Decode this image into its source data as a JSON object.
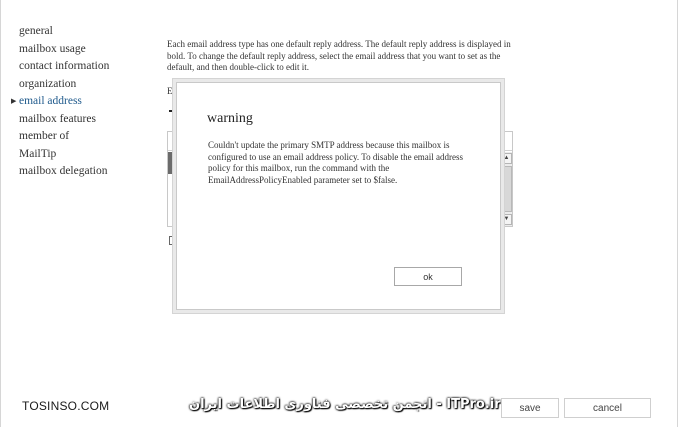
{
  "nav": {
    "items": [
      {
        "label": "general"
      },
      {
        "label": "mailbox usage"
      },
      {
        "label": "contact information"
      },
      {
        "label": "organization"
      },
      {
        "label": "email address"
      },
      {
        "label": "mailbox features"
      },
      {
        "label": "member of"
      },
      {
        "label": "MailTip"
      },
      {
        "label": "mailbox delegation"
      }
    ],
    "active_marker": "▶"
  },
  "content": {
    "description": "Each email address type has one default reply address. The default reply address is displayed in bold. To change the default reply address, select the email address that you want to set as the default, and then double-click to edit it.",
    "field_label": "Er"
  },
  "scrollbar": {
    "up_glyph": "▲",
    "down_glyph": "▼"
  },
  "dialog": {
    "title": "warning",
    "message": "Couldn't update the primary SMTP address because this mailbox is configured to use an email address policy. To disable the email address policy for this mailbox, run the command with the EmailAddressPolicyEnabled parameter set to $false.",
    "ok_label": "ok"
  },
  "footer": {
    "save_label": "save",
    "cancel_label": "cancel"
  },
  "watermark": {
    "left_text": "TOSINSO.COM",
    "right_text": "انجمن تخصصی فناوری اطلاعات ایران - ITPro.ir"
  }
}
